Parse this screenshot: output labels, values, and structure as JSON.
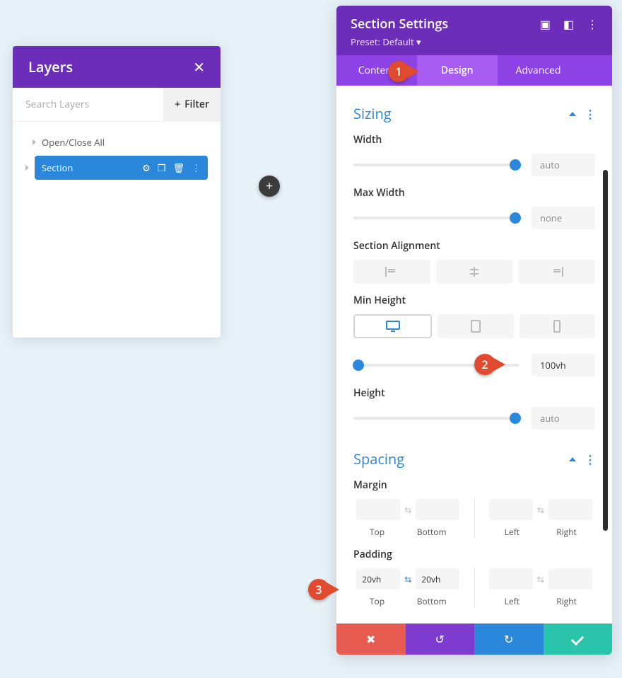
{
  "layers": {
    "title": "Layers",
    "search_placeholder": "Search Layers",
    "filter_label": "Filter",
    "open_close_label": "Open/Close All",
    "section_item": "Section"
  },
  "round_plus": "+",
  "settings": {
    "title": "Section Settings",
    "preset_label": "Preset: Default",
    "tabs": {
      "content": "Content",
      "design": "Design",
      "advanced": "Advanced",
      "active": "design"
    },
    "sizing": {
      "group": "Sizing",
      "width_label": "Width",
      "width_value": "auto",
      "max_width_label": "Max Width",
      "max_width_value": "none",
      "alignment_label": "Section Alignment",
      "min_height_label": "Min Height",
      "min_height_value": "100vh",
      "height_label": "Height",
      "height_value": "auto"
    },
    "spacing": {
      "group": "Spacing",
      "margin_label": "Margin",
      "padding_label": "Padding",
      "top": "Top",
      "bottom": "Bottom",
      "left": "Left",
      "right": "Right",
      "padding_top": "20vh",
      "padding_bottom": "20vh"
    }
  },
  "callouts": {
    "c1": "1",
    "c2": "2",
    "c3": "3"
  }
}
